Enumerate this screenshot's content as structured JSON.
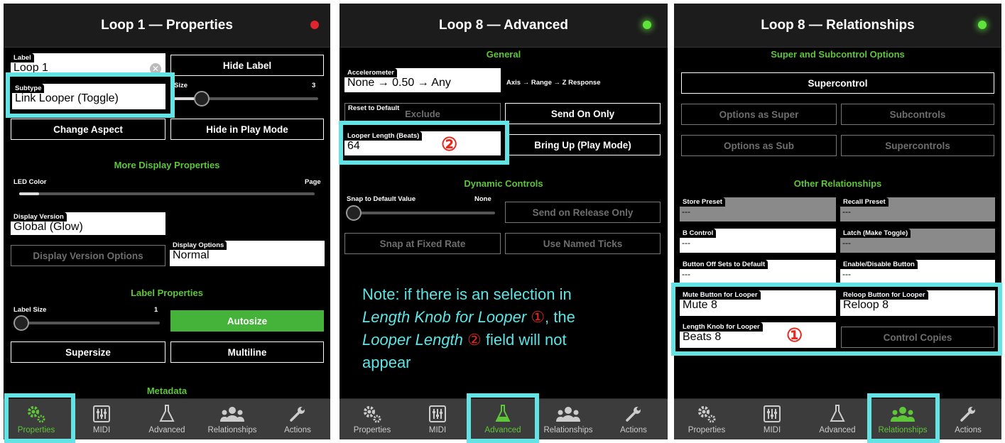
{
  "colors": {
    "accent_green": "#5ec639",
    "highlight_cyan": "#64e3e5",
    "marker_red": "#e8271e"
  },
  "tabs": [
    {
      "label": "Properties",
      "icon": "gears-icon"
    },
    {
      "label": "MIDI",
      "icon": "sliders-icon"
    },
    {
      "label": "Advanced",
      "icon": "flask-icon"
    },
    {
      "label": "Relationships",
      "icon": "people-icon"
    },
    {
      "label": "Actions",
      "icon": "wrench-icon"
    }
  ],
  "panel1": {
    "title": "Loop 1 — Properties",
    "label_field": {
      "tab": "Label",
      "value": "Loop 1"
    },
    "hide_label": "Hide Label",
    "subtype": {
      "tab": "Subtype",
      "value": "Link Looper (Toggle)"
    },
    "size": {
      "label": "Size",
      "value": "3"
    },
    "change_aspect": "Change Aspect",
    "hide_in_play_mode": "Hide in Play Mode",
    "more_display_properties": "More Display Properties",
    "led_color": "LED Color",
    "page": "Page",
    "display_version": {
      "tab": "Display Version",
      "value": "Global (Glow)"
    },
    "display_version_options": "Display Version Options",
    "display_options": {
      "tab": "Display Options",
      "value": "Normal"
    },
    "label_properties": "Label Properties",
    "label_size": {
      "label": "Label Size",
      "value": "1"
    },
    "autosize": "Autosize",
    "supersize": "Supersize",
    "multiline": "Multiline",
    "metadata": "Metadata",
    "active_tab": 0
  },
  "panel2": {
    "title": "Loop 8 — Advanced",
    "general": "General",
    "accelerometer": {
      "tab": "Accelerometer",
      "value": "None → 0.50 → Any"
    },
    "axis_hint": "Axis → Range → Z Response",
    "reset_to_default": {
      "tab": "Reset to Default",
      "value": "Exclude"
    },
    "send_on_only": "Send On Only",
    "looper_length": {
      "tab": "Looper Length (Beats)",
      "value": "64",
      "marker": "②"
    },
    "bring_up": "Bring Up (Play Mode)",
    "dynamic_controls": "Dynamic Controls",
    "snap_to_default": {
      "label": "Snap to Default Value",
      "value": "None"
    },
    "send_on_release_only": "Send on Release Only",
    "snap_at_fixed_rate": "Snap at Fixed Rate",
    "use_named_ticks": "Use Named Ticks",
    "note": {
      "p1": "Note: if there is an selection in",
      "p2_italic": "Length Knob for Looper",
      "p2_marker": "①",
      "p2_tail": ", the",
      "p3_italic": "Looper Length",
      "p3_marker": "②",
      "p3_tail": " field will not",
      "p4": "appear"
    },
    "active_tab": 2
  },
  "panel3": {
    "title": "Loop 8 — Relationships",
    "super_sub_options": "Super and Subcontrol Options",
    "supercontrol": "Supercontrol",
    "options_as_super": "Options as Super",
    "subcontrols": "Subcontrols",
    "options_as_sub": "Options as Sub",
    "supercontrols": "Supercontrols",
    "other_relationships": "Other Relationships",
    "store_preset": {
      "tab": "Store Preset",
      "value": "---"
    },
    "recall_preset": {
      "tab": "Recall Preset",
      "value": "---"
    },
    "b_control": {
      "tab": "B Control",
      "value": "---"
    },
    "latch": {
      "tab": "Latch (Make Toggle)",
      "value": "---"
    },
    "button_off_sets": {
      "tab": "Button Off Sets to Default",
      "value": "---"
    },
    "enable_disable": {
      "tab": "Enable/Disable Button",
      "value": "---"
    },
    "mute_button": {
      "tab": "Mute Button for Looper",
      "value": "Mute 8"
    },
    "reloop_button": {
      "tab": "Reloop Button for Looper",
      "value": "Reloop 8"
    },
    "length_knob": {
      "tab": "Length Knob for Looper",
      "value": "Beats 8",
      "marker": "①"
    },
    "control_copies": "Control Copies",
    "active_tab": 3
  }
}
